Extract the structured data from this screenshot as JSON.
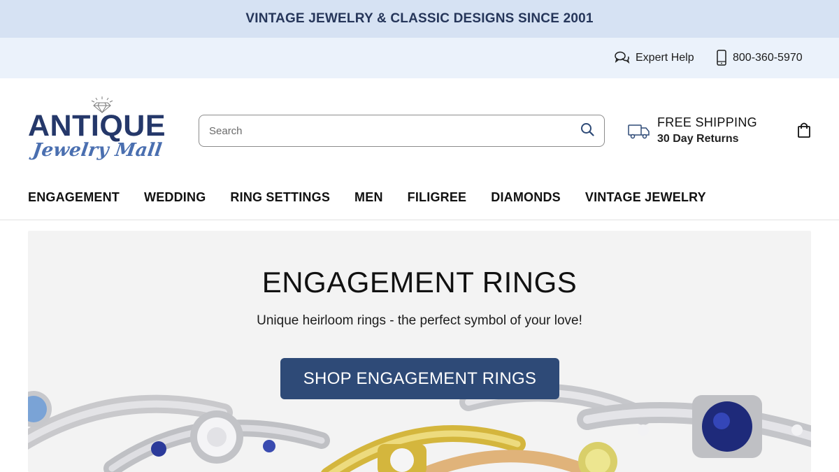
{
  "announcement": {
    "text": "VINTAGE JEWELRY & CLASSIC DESIGNS SINCE 2001"
  },
  "utility": {
    "help_label": "Expert Help",
    "phone": "800-360-5970"
  },
  "header": {
    "logo": {
      "main": "ANTIQUE",
      "script": "Jewelry Mall"
    },
    "search": {
      "placeholder": "Search",
      "value": ""
    },
    "shipping": {
      "line1": "FREE SHIPPING",
      "line2": "30 Day Returns"
    }
  },
  "nav": {
    "items": [
      {
        "label": "ENGAGEMENT"
      },
      {
        "label": "WEDDING"
      },
      {
        "label": "RING SETTINGS"
      },
      {
        "label": "MEN"
      },
      {
        "label": "FILIGREE"
      },
      {
        "label": "DIAMONDS"
      },
      {
        "label": "VINTAGE JEWELRY"
      }
    ]
  },
  "hero": {
    "title": "ENGAGEMENT RINGS",
    "subtitle": "Unique heirloom rings - the perfect symbol of your love!",
    "cta": "SHOP ENGAGEMENT RINGS"
  },
  "icons": {
    "help": "chat-bubbles-icon",
    "phone": "mobile-phone-icon",
    "search": "search-icon",
    "shipping": "truck-icon",
    "cart": "shopping-bag-icon",
    "logo_mark": "diamond-icon"
  },
  "colors": {
    "announcement_bg": "#d6e2f3",
    "utility_bg": "#ebf2fb",
    "brand_navy": "#25386a",
    "cta_bg": "#2e4a77",
    "hero_bg": "#f3f3f3"
  }
}
